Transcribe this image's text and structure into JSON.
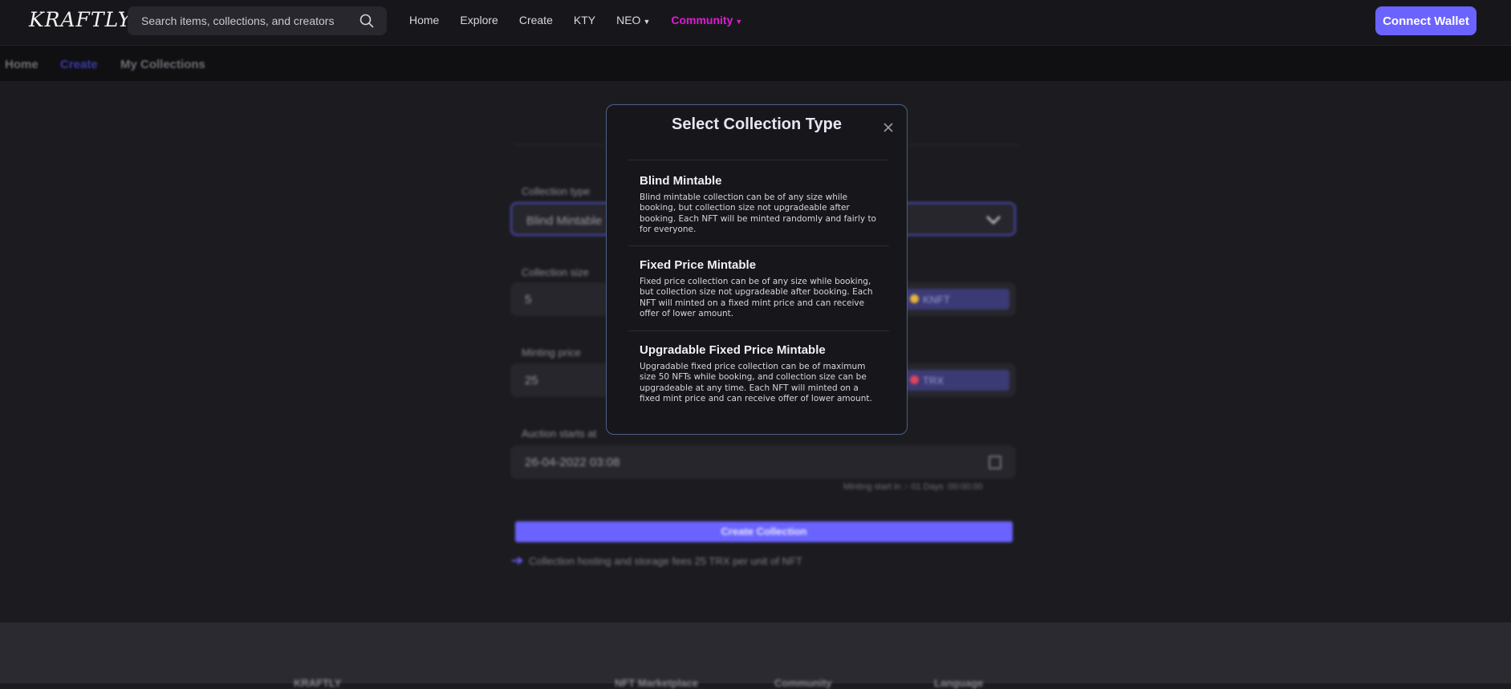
{
  "header": {
    "logo": "KRAFTLY",
    "search_placeholder": "Search items, collections, and creators",
    "nav": [
      {
        "label": "Home",
        "active": false,
        "dropdown": false
      },
      {
        "label": "Explore",
        "active": false,
        "dropdown": false
      },
      {
        "label": "Create",
        "active": false,
        "dropdown": false
      },
      {
        "label": "KTY",
        "active": false,
        "dropdown": false
      },
      {
        "label": "NEO",
        "active": false,
        "dropdown": true
      },
      {
        "label": "Community",
        "active": true,
        "dropdown": true
      }
    ],
    "connect_label": "Connect Wallet"
  },
  "subnav": {
    "home": "Home",
    "create": "Create",
    "my_collections": "My Collections"
  },
  "form": {
    "collection_type_label": "Collection type",
    "collection_type_value": "Blind Mintable",
    "collection_size_label": "Collection size",
    "collection_size_value": "5",
    "collection_size_token": "KNFT",
    "minting_price_label": "Minting price",
    "minting_price_value": "25",
    "minting_price_token": "TRX",
    "auction_label": "Auction starts at",
    "auction_value": "26-04-2022 03:08",
    "minting_start": "Minting start in :- 01 Days :00:00:00",
    "create_button": "Create Collection",
    "fee_note": "Collection hosting and storage fees 25 TRX per unit of NFT"
  },
  "footer": {
    "brand": "KRAFTLY",
    "marketplace": "NFT Marketplace",
    "community": "Community",
    "language": "Language"
  },
  "modal": {
    "title": "Select Collection Type",
    "options": [
      {
        "title": "Blind Mintable",
        "description": "Blind mintable collection can be of any size while booking, but collection size not upgradeable after booking. Each NFT will be minted randomly and fairly to for everyone."
      },
      {
        "title": "Fixed Price Mintable",
        "description": "Fixed price collection can be of any size while booking, but collection size not upgradeable after booking. Each NFT will minted on a fixed mint price and can receive offer of lower amount."
      },
      {
        "title": "Upgradable Fixed Price Mintable",
        "description": "Upgradable fixed price collection can be of maximum size 50 NFTs while booking, and collection size can be upgradeable at any time. Each NFT will minted on a fixed mint price and can receive offer of lower amount."
      }
    ]
  },
  "colors": {
    "accent": "#6b63ff",
    "community": "#e01bd3",
    "modal_border": "#4b5f86"
  }
}
